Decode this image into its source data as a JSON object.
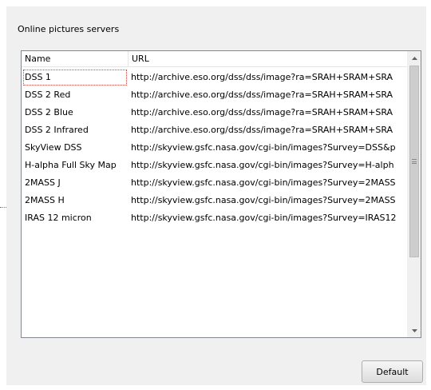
{
  "group": {
    "title": "Online pictures servers"
  },
  "table": {
    "columns": [
      "Name",
      "URL"
    ],
    "rows": [
      {
        "name": "DSS 1",
        "url": "http://archive.eso.org/dss/dss/image?ra=SRAH+SRAM+SRA"
      },
      {
        "name": "DSS 2 Red",
        "url": "http://archive.eso.org/dss/dss/image?ra=SRAH+SRAM+SRA"
      },
      {
        "name": "DSS 2 Blue",
        "url": "http://archive.eso.org/dss/dss/image?ra=SRAH+SRAM+SRA"
      },
      {
        "name": "DSS 2 Infrared",
        "url": "http://archive.eso.org/dss/dss/image?ra=SRAH+SRAM+SRA"
      },
      {
        "name": "SkyView DSS",
        "url": "http://skyview.gsfc.nasa.gov/cgi-bin/images?Survey=DSS&p"
      },
      {
        "name": "H-alpha Full Sky Map",
        "url": "http://skyview.gsfc.nasa.gov/cgi-bin/images?Survey=H-alph"
      },
      {
        "name": "2MASS J",
        "url": "http://skyview.gsfc.nasa.gov/cgi-bin/images?Survey=2MASS"
      },
      {
        "name": "2MASS H",
        "url": "http://skyview.gsfc.nasa.gov/cgi-bin/images?Survey=2MASS"
      },
      {
        "name": "IRAS 12 micron",
        "url": "http://skyview.gsfc.nasa.gov/cgi-bin/images?Survey=IRAS12"
      }
    ]
  },
  "scrollbar": {
    "up_icon": "chevron-up-icon",
    "down_icon": "chevron-down-icon",
    "grip_icon": "grip-icon"
  },
  "buttons": {
    "default_label": "Default"
  },
  "colors": {
    "dialog_bg": "#f0f0f0",
    "list_border": "#828790",
    "focus_outline": "#c0504d"
  }
}
